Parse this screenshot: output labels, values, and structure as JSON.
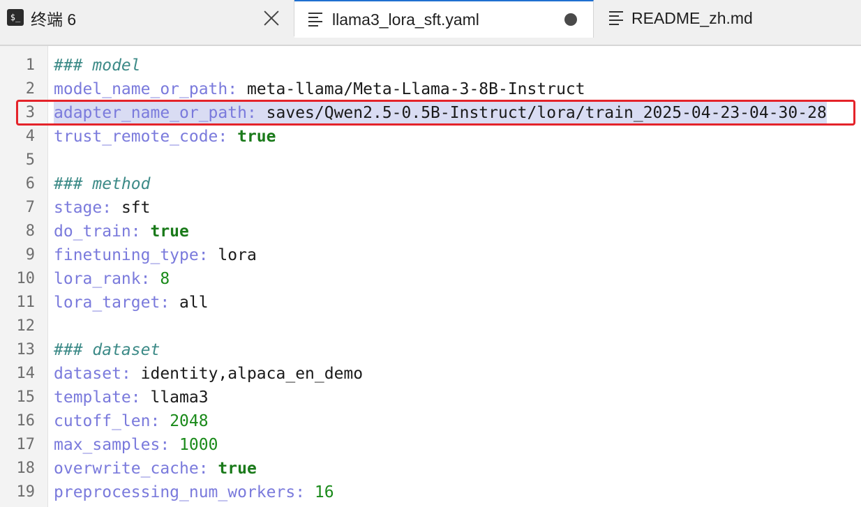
{
  "tabs": [
    {
      "label": "终端 6",
      "icon": "terminal-icon",
      "icon_text": "$_",
      "closable": true
    },
    {
      "label": "llama3_lora_sft.yaml",
      "icon": "document-icon",
      "active": true,
      "modified": true
    },
    {
      "label": "README_zh.md",
      "icon": "document-icon"
    }
  ],
  "editor": {
    "lines": [
      {
        "n": "1",
        "kind": "comment",
        "text": "### model"
      },
      {
        "n": "2",
        "kind": "kv",
        "key": "model_name_or_path",
        "sep": ": ",
        "value": "meta-llama/Meta-Llama-3-8B-Instruct",
        "vtype": "str"
      },
      {
        "n": "3",
        "kind": "kv",
        "key": "adapter_name_or_path",
        "sep": ": ",
        "value": "saves/Qwen2.5-0.5B-Instruct/lora/train_2025-04-23-04-30-28",
        "vtype": "str",
        "highlight": true
      },
      {
        "n": "4",
        "kind": "kv",
        "key": "trust_remote_code",
        "sep": ": ",
        "value": "true",
        "vtype": "bool"
      },
      {
        "n": "5",
        "kind": "blank"
      },
      {
        "n": "6",
        "kind": "comment",
        "text": "### method"
      },
      {
        "n": "7",
        "kind": "kv",
        "key": "stage",
        "sep": ": ",
        "value": "sft",
        "vtype": "str"
      },
      {
        "n": "8",
        "kind": "kv",
        "key": "do_train",
        "sep": ": ",
        "value": "true",
        "vtype": "bool"
      },
      {
        "n": "9",
        "kind": "kv",
        "key": "finetuning_type",
        "sep": ": ",
        "value": "lora",
        "vtype": "str"
      },
      {
        "n": "10",
        "kind": "kv",
        "key": "lora_rank",
        "sep": ": ",
        "value": "8",
        "vtype": "num"
      },
      {
        "n": "11",
        "kind": "kv",
        "key": "lora_target",
        "sep": ": ",
        "value": "all",
        "vtype": "str"
      },
      {
        "n": "12",
        "kind": "blank"
      },
      {
        "n": "13",
        "kind": "comment",
        "text": "### dataset"
      },
      {
        "n": "14",
        "kind": "kv",
        "key": "dataset",
        "sep": ": ",
        "value": "identity,alpaca_en_demo",
        "vtype": "str"
      },
      {
        "n": "15",
        "kind": "kv",
        "key": "template",
        "sep": ": ",
        "value": "llama3",
        "vtype": "str"
      },
      {
        "n": "16",
        "kind": "kv",
        "key": "cutoff_len",
        "sep": ": ",
        "value": "2048",
        "vtype": "num"
      },
      {
        "n": "17",
        "kind": "kv",
        "key": "max_samples",
        "sep": ": ",
        "value": "1000",
        "vtype": "num"
      },
      {
        "n": "18",
        "kind": "kv",
        "key": "overwrite_cache",
        "sep": ": ",
        "value": "true",
        "vtype": "bool"
      },
      {
        "n": "19",
        "kind": "kv",
        "key": "preprocessing_num_workers",
        "sep": ": ",
        "value": "16",
        "vtype": "num"
      }
    ]
  },
  "colors": {
    "key": "#7a7adc",
    "comment": "#3c8a87",
    "bool": "#1a7a1a",
    "number": "#1a8a1a",
    "highlight_border": "#e4232a",
    "selection": "#d9dcf3"
  }
}
